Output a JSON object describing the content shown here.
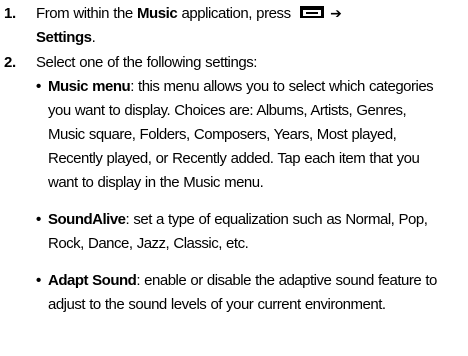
{
  "steps": [
    {
      "number": "1.",
      "line1_prefix": "From within the ",
      "line1_bold": "Music",
      "line1_suffix": " application, press ",
      "icon": "menu-key-icon",
      "arrow": "➔",
      "line2_bold": "Settings",
      "line2_suffix": "."
    },
    {
      "number": "2.",
      "text": "Select one of the following settings:"
    }
  ],
  "settings": [
    {
      "bullet": "•",
      "label": "Music menu",
      "lines": [
        ": this menu allows you to select which categories",
        "you want to display. Choices are: Albums, Artists, Genres,",
        "Music square, Folders, Composers, Years, Most played,",
        "Recently played, or Recently added. Tap each item that you",
        "want to display in the Music menu."
      ]
    },
    {
      "bullet": "•",
      "label": "SoundAlive",
      "lines": [
        ": set a type of equalization such as Normal, Pop,",
        "Rock, Dance, Jazz, Classic, etc."
      ]
    },
    {
      "bullet": "•",
      "label": "Adapt Sound",
      "lines": [
        ": enable or disable the adaptive sound feature to",
        "adjust to the sound levels of your current environment."
      ]
    }
  ]
}
